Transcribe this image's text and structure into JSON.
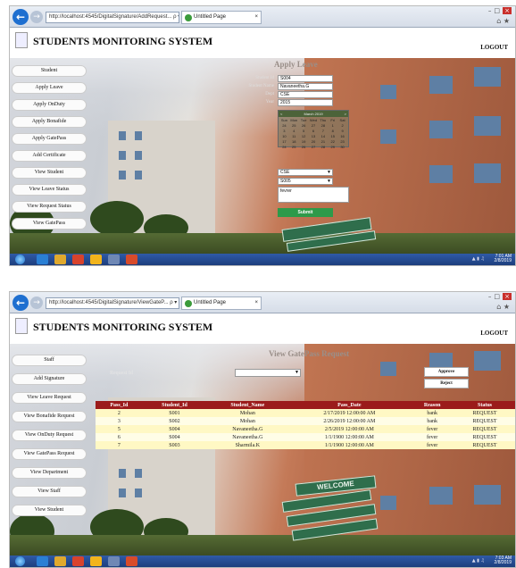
{
  "screen1": {
    "browser": {
      "address": "http://localhost:4545/DigitalSignature/AddRequest... ρ ▾ ☒ ↻",
      "tab_title": "Untitled Page"
    },
    "app": {
      "title": "STUDENTS MONITORING SYSTEM",
      "logout": "LOGOUT"
    },
    "menu": [
      "Student",
      "Apply Leave",
      "Apply OnDuty",
      "Apply Bonafide",
      "Apply GatePass",
      "Add Certificate",
      "View Student",
      "View Leave Status",
      "View Request Status",
      "View GatePass"
    ],
    "form": {
      "title": "Apply Leave",
      "fields": [
        {
          "label": "Student Id",
          "value": "S004"
        },
        {
          "label": "Student Name",
          "value": "Navaneetha.G"
        },
        {
          "label": "Dept",
          "value": "CSE"
        },
        {
          "label": "Year",
          "value": "2015"
        }
      ],
      "calendar": {
        "month": "March 2019",
        "weekdays": [
          "Sun",
          "Mon",
          "Tue",
          "Wed",
          "Thu",
          "Fri",
          "Sat"
        ],
        "days": [
          "24",
          "25",
          "26",
          "27",
          "28",
          "1",
          "2",
          "3",
          "4",
          "5",
          "6",
          "7",
          "8",
          "9",
          "10",
          "11",
          "12",
          "13",
          "14",
          "15",
          "16",
          "17",
          "18",
          "19",
          "20",
          "21",
          "22",
          "23",
          "24",
          "25",
          "26",
          "27",
          "28",
          "29",
          "30"
        ]
      },
      "dept_select": "CSE",
      "student_select": "S005",
      "reason": "fevrer",
      "submit": "Submit"
    },
    "taskbar": {
      "time": "7:01 AM",
      "date": "2/8/2019"
    }
  },
  "screen2": {
    "browser": {
      "address": "http://localhost:4545/DigitalSignature/ViewGateP... ρ ▾ ☒ ↻",
      "tab_title": "Untitled Page"
    },
    "app": {
      "title": "STUDENTS MONITORING SYSTEM",
      "logout": "LOGOUT"
    },
    "menu": [
      "Staff",
      "Add Signature",
      "View Leave Request",
      "View Bonafide Request",
      "View OnDuty Request",
      "View GatePass Request",
      "View Department",
      "View Staff",
      "View Student"
    ],
    "page_title": "View GatePass Request",
    "request_id_label": "Request Id",
    "approve": "Approve",
    "reject": "Reject",
    "table": {
      "headers": [
        "Pass_Id",
        "Student_Id",
        "Student_Name",
        "Pass_Date",
        "Reason",
        "Status"
      ],
      "rows": [
        [
          "2",
          "S001",
          "Mohan",
          "2/17/2019 12:00:00 AM",
          "bank",
          "REQUEST"
        ],
        [
          "3",
          "S002",
          "Mohan",
          "2/26/2019 12:00:00 AM",
          "bank",
          "REQUEST"
        ],
        [
          "5",
          "S004",
          "Navaneetha.G",
          "2/5/2019 12:00:00 AM",
          "fever",
          "REQUEST"
        ],
        [
          "6",
          "S004",
          "Navaneetha.G",
          "1/1/1900 12:00:00 AM",
          "fever",
          "REQUEST"
        ],
        [
          "7",
          "S003",
          "Sharmila.K",
          "1/1/1900 12:00:00 AM",
          "fever",
          "REQUEST"
        ]
      ]
    },
    "sign_text": "WELCOME",
    "taskbar": {
      "time": "7:03 AM",
      "date": "2/8/2019"
    }
  },
  "colors": {
    "table_header": "#9b1b1b",
    "taskbar": "#1d3e7d",
    "submit": "#2d9a4a"
  }
}
